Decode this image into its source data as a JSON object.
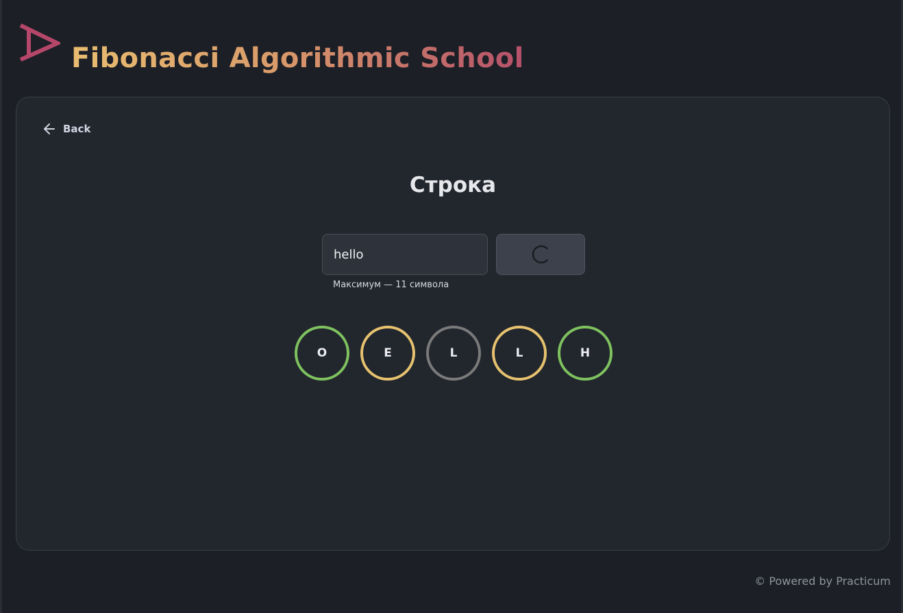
{
  "header": {
    "logo_icon": "fibonacci-logo-icon",
    "title": "Fibonacci Algorithmic School"
  },
  "nav": {
    "back_label": "Back",
    "back_icon": "arrow-left-icon"
  },
  "page": {
    "title": "Строка"
  },
  "form": {
    "input_value": "hello",
    "hint": "Максимум — 11 символа",
    "submit_state": "loading",
    "submit_icon": "spinner-icon"
  },
  "circles": [
    {
      "letter": "O",
      "color": "#7ec15f"
    },
    {
      "letter": "E",
      "color": "#e6c26f"
    },
    {
      "letter": "L",
      "color": "#7a7a7a"
    },
    {
      "letter": "L",
      "color": "#e6c26f"
    },
    {
      "letter": "H",
      "color": "#7ec15f"
    }
  ],
  "footer": {
    "text": "© Powered by Practicum"
  },
  "colors": {
    "background": "#1c1f26",
    "card": "#22262d",
    "changing": "#e6c26f",
    "modified": "#7ec15f",
    "default": "#7a7a7a",
    "logo": "#b5476a"
  }
}
